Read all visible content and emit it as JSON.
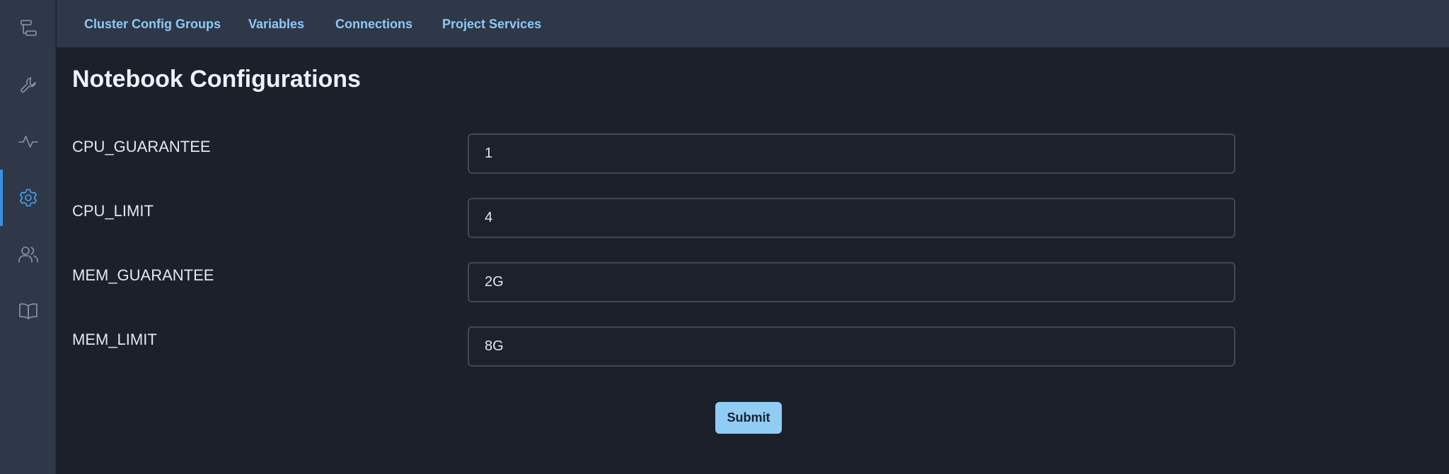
{
  "sidebar": {
    "items": [
      {
        "icon": "workflow-icon",
        "active": false
      },
      {
        "icon": "wrench-icon",
        "active": false
      },
      {
        "icon": "activity-icon",
        "active": false
      },
      {
        "icon": "gear-icon",
        "active": true
      },
      {
        "icon": "users-icon",
        "active": false
      },
      {
        "icon": "book-icon",
        "active": false
      }
    ],
    "active_color": "#4aa3f0"
  },
  "topnav": {
    "tabs": [
      {
        "label": "Cluster Config Groups"
      },
      {
        "label": "Variables"
      },
      {
        "label": "Connections"
      },
      {
        "label": "Project Services"
      }
    ],
    "tab_color": "#8fc8f6"
  },
  "main": {
    "title": "Notebook Configurations",
    "fields": [
      {
        "label": "CPU_GUARANTEE",
        "value": "1"
      },
      {
        "label": "CPU_LIMIT",
        "value": "4"
      },
      {
        "label": "MEM_GUARANTEE",
        "value": "2G"
      },
      {
        "label": "MEM_LIMIT",
        "value": "8G"
      }
    ],
    "submit_label": "Submit",
    "submit_color": "#90cdf4"
  }
}
